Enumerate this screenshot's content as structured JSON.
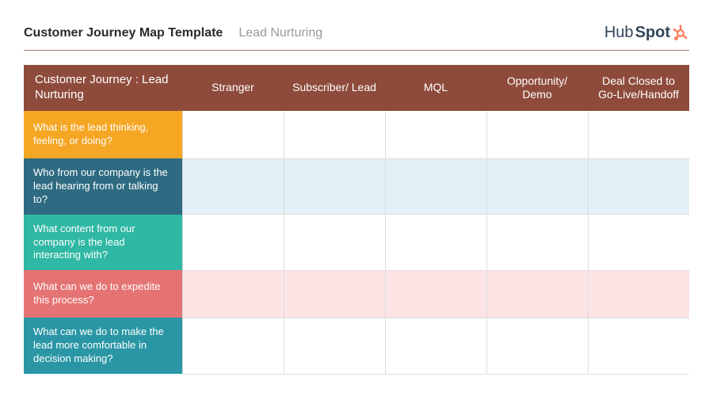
{
  "header": {
    "title": "Customer Journey Map Template",
    "subtitle": "Lead Nurturing",
    "logo_text_1": "Hub",
    "logo_text_2": "Spot"
  },
  "table": {
    "corner_label": "Customer Journey : Lead Nurturing",
    "columns": [
      "Stranger",
      "Subscriber/ Lead",
      "MQL",
      "Opportunity/ Demo",
      "Deal Closed to Go-Live/Handoff"
    ],
    "rows": [
      {
        "label": "What is the lead thinking, feeling, or doing?",
        "label_bg": "#f5a623",
        "cell_bg": "#ffffff"
      },
      {
        "label": "Who from our company is the lead hearing from or talking to?",
        "label_bg": "#2e6b82",
        "cell_bg": "#e3f0f7"
      },
      {
        "label": "What content from our company is the lead interacting with?",
        "label_bg": "#2fb8a3",
        "cell_bg": "#ffffff"
      },
      {
        "label": "What can we do to expedite this process?",
        "label_bg": "#e57373",
        "cell_bg": "#fce4e4"
      },
      {
        "label": "What can we do to make the lead more comfortable in decision making?",
        "label_bg": "#2a96a5",
        "cell_bg": "#ffffff"
      }
    ]
  },
  "colors": {
    "header_bg": "#8e4b3c",
    "accent": "#ff7a59"
  }
}
